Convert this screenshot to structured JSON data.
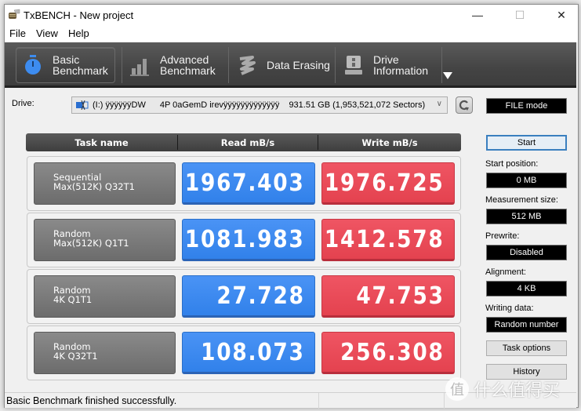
{
  "window": {
    "title": "TxBENCH - New project",
    "controls": {
      "minimize": "—",
      "maximize": "☐",
      "close": "✕"
    }
  },
  "menu": [
    "File",
    "View",
    "Help"
  ],
  "toolbar": {
    "tabs": [
      {
        "line1": "Basic",
        "line2": "Benchmark",
        "icon": "stopwatch-icon",
        "active": true
      },
      {
        "line1": "Advanced",
        "line2": "Benchmark",
        "icon": "bar-chart-icon",
        "active": false
      },
      {
        "line1": "Data Erasing",
        "line2": "",
        "icon": "eraser-icon",
        "active": false
      },
      {
        "line1": "Drive",
        "line2": "Information",
        "icon": "drive-info-icon",
        "active": false
      }
    ],
    "more_icon": "dropdown-triangle-icon"
  },
  "drive": {
    "label": "Drive:",
    "selected_name": "(I:) ÿÿÿÿÿÿDW",
    "selected_model": "4P 0aGemD irevÿÿÿÿÿÿÿÿÿÿÿÿÿ",
    "selected_capacity": "931.51 GB (1,953,521,072 Sectors)",
    "mode": "FILE mode"
  },
  "table": {
    "headers": [
      "Task name",
      "Read mB/s",
      "Write mB/s"
    ],
    "rows": [
      {
        "task_line1": "Sequential",
        "task_line2": "Max(512K) Q32T1",
        "read": "1967.403",
        "write": "1976.725"
      },
      {
        "task_line1": "Random",
        "task_line2": "Max(512K) Q1T1",
        "read": "1081.983",
        "write": "1412.578"
      },
      {
        "task_line1": "Random",
        "task_line2": "4K Q1T1",
        "read": "27.728",
        "write": "47.753"
      },
      {
        "task_line1": "Random",
        "task_line2": "4K Q32T1",
        "read": "108.073",
        "write": "256.308"
      }
    ]
  },
  "sidebar": {
    "start_label": "Start",
    "start_position_label": "Start position:",
    "start_position_value": "0 MB",
    "measurement_size_label": "Measurement size:",
    "measurement_size_value": "512 MB",
    "prewrite_label": "Prewrite:",
    "prewrite_value": "Disabled",
    "alignment_label": "Alignment:",
    "alignment_value": "4 KB",
    "writing_data_label": "Writing data:",
    "writing_data_value": "Random number",
    "task_options_label": "Task options",
    "history_label": "History"
  },
  "status": {
    "message": "Basic Benchmark finished successfully."
  },
  "watermark": {
    "badge": "值",
    "text": "什么值得买"
  },
  "colors": {
    "read": "#3a88ef",
    "write": "#e94b58",
    "toolbar": "#4a4a4a",
    "task": "#7b7b7b"
  }
}
